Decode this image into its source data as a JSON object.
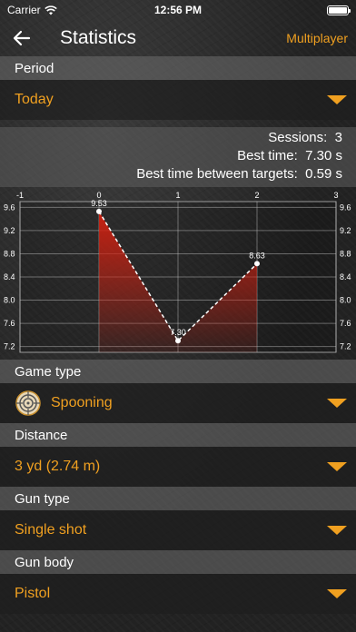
{
  "status": {
    "carrier": "Carrier",
    "time": "12:56 PM"
  },
  "nav": {
    "title": "Statistics",
    "right_button": "Multiplayer"
  },
  "period": {
    "header": "Period",
    "value": "Today"
  },
  "stats": {
    "sessions_label": "Sessions:",
    "sessions_value": "3",
    "best_time_label": "Best time:",
    "best_time_value": "7.30 s",
    "best_between_label": "Best time between targets:",
    "best_between_value": "0.59 s"
  },
  "chart_data": {
    "type": "line",
    "x": [
      0,
      1,
      2
    ],
    "y": [
      9.53,
      7.3,
      8.63
    ],
    "point_labels": [
      "9.53",
      "7.30",
      "8.63"
    ],
    "xlim": [
      -1,
      3
    ],
    "x_ticks": [
      "-1",
      "0",
      "1",
      "2",
      "3"
    ],
    "ylim": [
      7.1,
      9.7
    ],
    "y_ticks": [
      "9.6",
      "9.2",
      "8.8",
      "8.4",
      "8.0",
      "7.6",
      "7.2"
    ],
    "y_tick_values": [
      9.6,
      9.2,
      8.8,
      8.4,
      8.0,
      7.6,
      7.2
    ],
    "line_style": "dashed",
    "fill_color": "#d02010",
    "grid": true
  },
  "game_type": {
    "header": "Game type",
    "value": "Spooning",
    "icon": "target-icon"
  },
  "distance": {
    "header": "Distance",
    "value": "3 yd (2.74 m)"
  },
  "gun_type": {
    "header": "Gun type",
    "value": "Single shot"
  },
  "gun_body": {
    "header": "Gun body",
    "value": "Pistol"
  },
  "colors": {
    "accent": "#f0a020"
  }
}
